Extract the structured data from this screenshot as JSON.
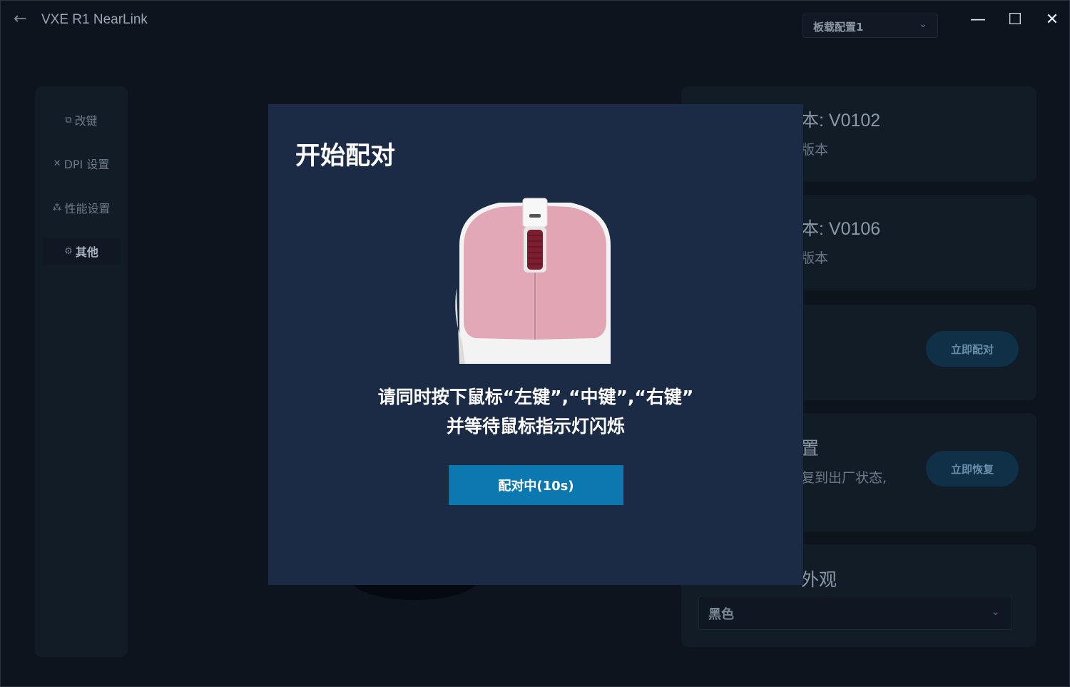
{
  "window": {
    "title": "VXE R1 NearLink",
    "profile": "板载配置1"
  },
  "sidebar": {
    "items": [
      {
        "label": "改键",
        "icon": "remap-icon"
      },
      {
        "label": "DPI 设置",
        "icon": "dpi-icon"
      },
      {
        "label": "性能设置",
        "icon": "performance-icon"
      },
      {
        "label": "其他",
        "icon": "gear-icon",
        "active": true
      }
    ]
  },
  "panels": {
    "fw1": {
      "version": "本:  V0102",
      "sub": "版本"
    },
    "fw2": {
      "version": "本:  V0106",
      "sub": "版本"
    },
    "pair_button": "立即配对",
    "reset": {
      "title": "置",
      "sub": "复到出厂状态,",
      "button": "立即恢复"
    },
    "appearance": {
      "title": "外观",
      "value": "黑色"
    }
  },
  "dialog": {
    "title": "开始配对",
    "line1": "请同时按下鼠标“左键”,“中键”,“右键”",
    "line2": "并等待鼠标指示灯闪烁",
    "button": "配对中(10s)"
  },
  "colors": {
    "dialog_bg": "#1b2b45",
    "button_bg": "#0b79b0",
    "mouse_shell": "#e3a8b7",
    "mouse_body": "#f2f2f2",
    "wheel": "#7a1e30"
  }
}
